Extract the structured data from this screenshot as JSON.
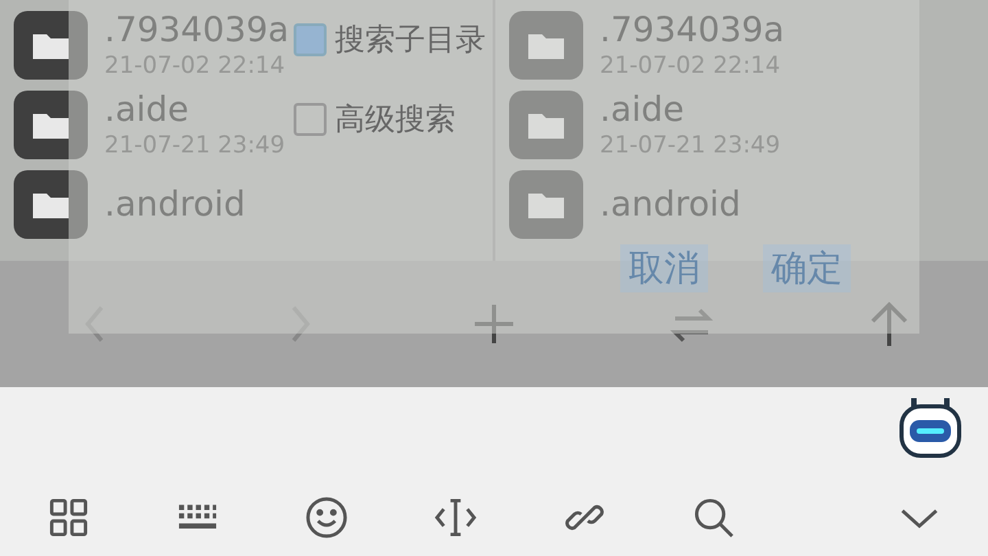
{
  "panes": [
    {
      "files": [
        {
          "name": ".7934039a",
          "date": "21-07-02 22:14"
        },
        {
          "name": ".aide",
          "date": "21-07-21 23:49"
        },
        {
          "name": ".android"
        }
      ]
    },
    {
      "files": [
        {
          "name": ".7934039a",
          "date": "21-07-02 22:14"
        },
        {
          "name": ".aide",
          "date": "21-07-21 23:49"
        },
        {
          "name": ".android"
        }
      ]
    }
  ],
  "dialog": {
    "options": [
      {
        "label": "搜索子目录",
        "checked": true
      },
      {
        "label": "高级搜索",
        "checked": false
      }
    ],
    "buttons": [
      "取消",
      "确定"
    ]
  },
  "keyboard_toolbar": {
    "items": [
      {
        "kind": "grid"
      },
      {
        "kind": "keyboard"
      },
      {
        "kind": "emoji"
      },
      {
        "kind": "cursor"
      },
      {
        "kind": "link"
      },
      {
        "kind": "search"
      },
      {
        "kind": "collapse"
      }
    ]
  }
}
